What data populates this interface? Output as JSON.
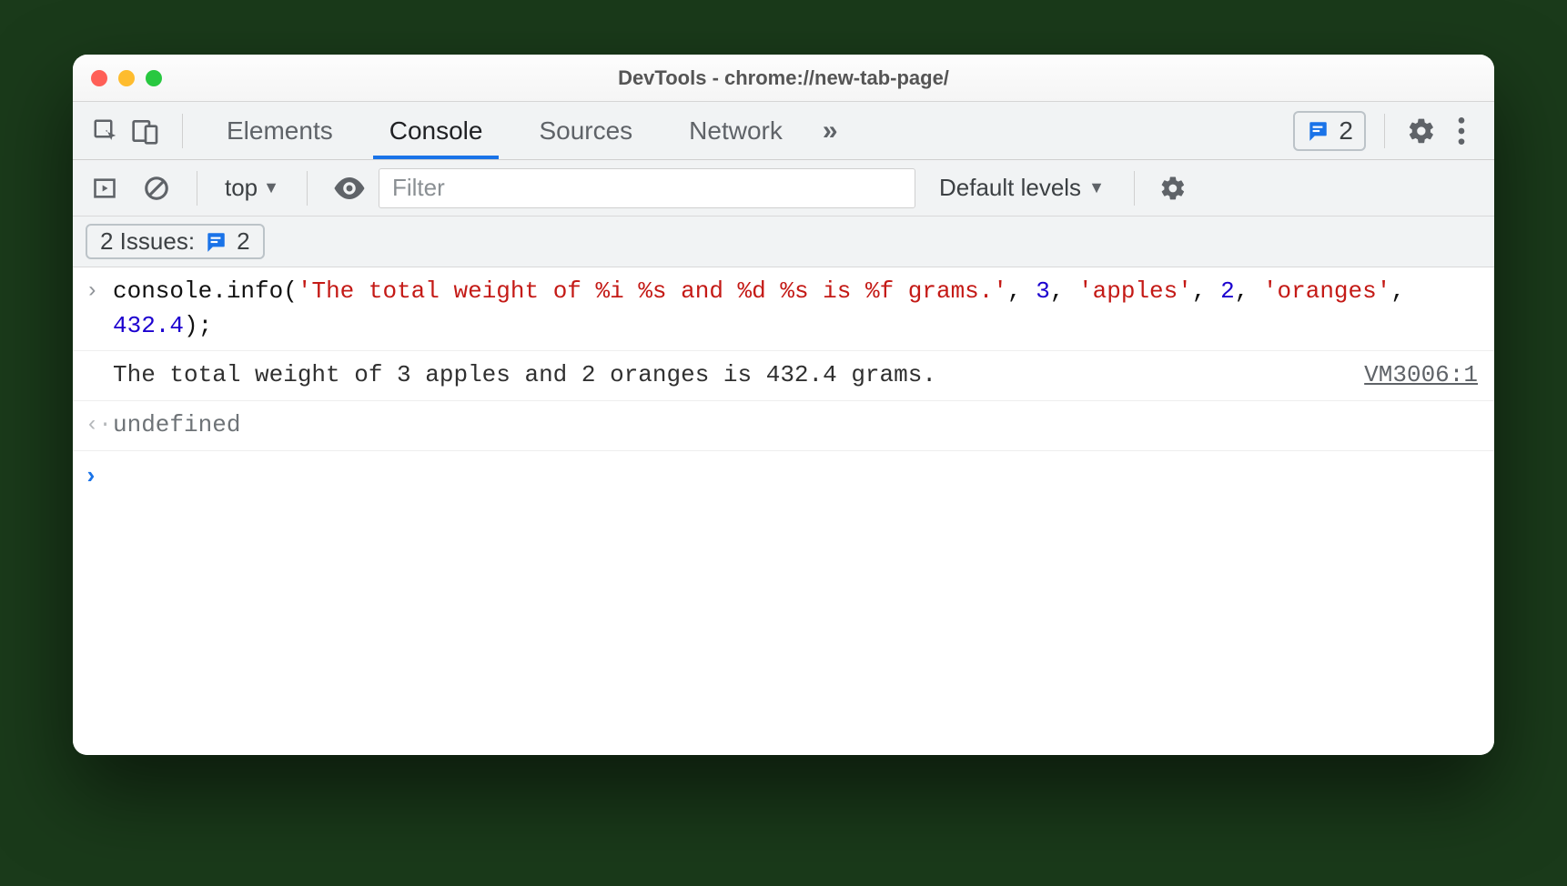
{
  "window": {
    "title": "DevTools - chrome://new-tab-page/"
  },
  "tabs": {
    "elements": "Elements",
    "console": "Console",
    "sources": "Sources",
    "network": "Network",
    "active": "Console"
  },
  "header_issues": {
    "count": "2"
  },
  "console_toolbar": {
    "context": "top",
    "filter_placeholder": "Filter",
    "levels_label": "Default levels"
  },
  "issues_row": {
    "label": "2 Issues:",
    "count": "2"
  },
  "console_entries": {
    "input": {
      "tokens": [
        {
          "t": "obj",
          "v": "console"
        },
        {
          "t": "punc",
          "v": "."
        },
        {
          "t": "method",
          "v": "info"
        },
        {
          "t": "punc",
          "v": "("
        },
        {
          "t": "str",
          "v": "'The total weight of %i %s and %d %s is %f grams.'"
        },
        {
          "t": "punc",
          "v": ", "
        },
        {
          "t": "num",
          "v": "3"
        },
        {
          "t": "punc",
          "v": ", "
        },
        {
          "t": "str",
          "v": "'apples'"
        },
        {
          "t": "punc",
          "v": ", "
        },
        {
          "t": "num",
          "v": "2"
        },
        {
          "t": "punc",
          "v": ", "
        },
        {
          "t": "str",
          "v": "'oranges'"
        },
        {
          "t": "punc",
          "v": ", "
        },
        {
          "t": "num",
          "v": "432.4"
        },
        {
          "t": "punc",
          "v": ");"
        }
      ]
    },
    "output": {
      "message": "The total weight of 3 apples and 2 oranges is 432.4 grams.",
      "source": "VM3006:1"
    },
    "return_value": "undefined"
  }
}
